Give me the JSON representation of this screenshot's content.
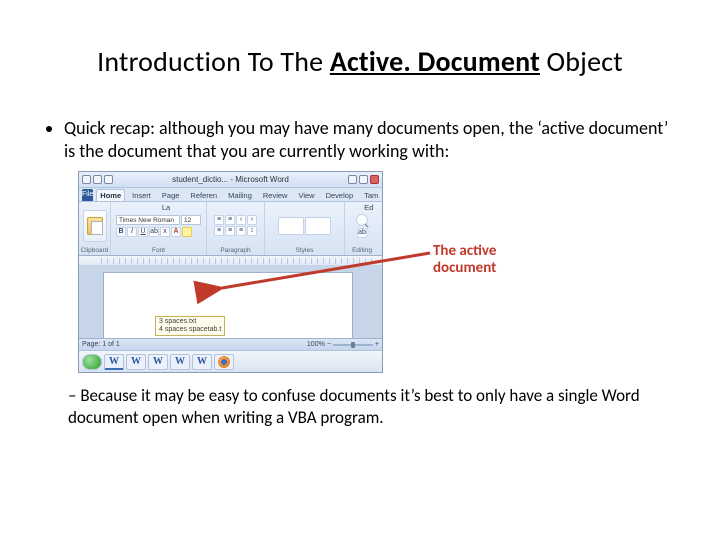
{
  "title": {
    "prefix": "Introduction To The ",
    "keyword": "Active. Document",
    "suffix": " Object"
  },
  "bullet1": "Quick recap: although you may have many documents open, the ‘active document’ is the document that you are currently working with:",
  "callout": {
    "line1": "The active",
    "line2": "document"
  },
  "bullet2": "Because it may be easy to confuse documents it’s best to only have a single Word document open when writing a VBA program.",
  "word": {
    "titlebar": "student_dictio...  -  Microsoft Word",
    "tabs": [
      "Home",
      "Insert",
      "Page La",
      "Referen",
      "Mailing",
      "Review",
      "View",
      "Develop",
      "Tam Ed"
    ],
    "font_name": "Times New Roman",
    "font_size": "12",
    "groups": {
      "clipboard": "Clipboard",
      "font": "Font",
      "paragraph": "Paragraph",
      "styles": "Styles",
      "editing": "Editing"
    },
    "tooltip": {
      "line1": "3 spaces.txt",
      "line2": "4 spaces    spacetab.t"
    },
    "status": {
      "page": "Page: 1 of 1",
      "zoom": "100%"
    }
  }
}
